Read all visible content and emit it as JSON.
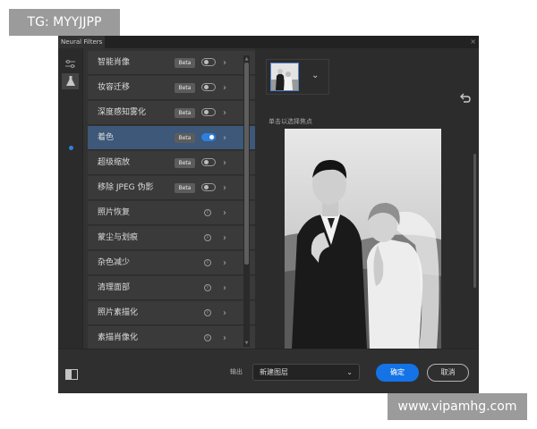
{
  "watermarks": {
    "top": "TG: MYYJJPP",
    "bottom": "www.vipamhg.com"
  },
  "window": {
    "tab_title": "Neural Filters",
    "close_glyph": "×"
  },
  "toolbar": {
    "tools": [
      {
        "icon": "sliders-icon"
      },
      {
        "icon": "flask-icon"
      }
    ],
    "indicator_color": "#2f7fde"
  },
  "filters": [
    {
      "label": "智能肖像",
      "badge": "Beta",
      "control": "toggle",
      "enabled": false
    },
    {
      "label": "妆容迁移",
      "badge": "Beta",
      "control": "toggle",
      "enabled": false
    },
    {
      "label": "深度感知雾化",
      "badge": "Beta",
      "control": "toggle",
      "enabled": false
    },
    {
      "label": "着色",
      "badge": "Beta",
      "control": "toggle",
      "enabled": true,
      "selected": true
    },
    {
      "label": "超级缩放",
      "badge": "Beta",
      "control": "toggle",
      "enabled": false
    },
    {
      "label": "移除 JPEG 伪影",
      "badge": "Beta",
      "control": "toggle",
      "enabled": false
    },
    {
      "label": "照片恢复",
      "control": "info"
    },
    {
      "label": "蒙尘与划痕",
      "control": "info"
    },
    {
      "label": "杂色减少",
      "control": "info"
    },
    {
      "label": "清理面部",
      "control": "info"
    },
    {
      "label": "照片素描化",
      "control": "info"
    },
    {
      "label": "素描肖像化",
      "control": "info"
    }
  ],
  "preview_panel": {
    "hint": "单击以选择焦点",
    "thumbnail_icon": "chevron-down-icon"
  },
  "bottom": {
    "output_label": "输出",
    "output_value": "新建图层",
    "ok_label": "确定",
    "cancel_label": "取消"
  },
  "colors": {
    "accent": "#1473e6",
    "selected_row": "#3d5879",
    "panel": "#323232"
  }
}
